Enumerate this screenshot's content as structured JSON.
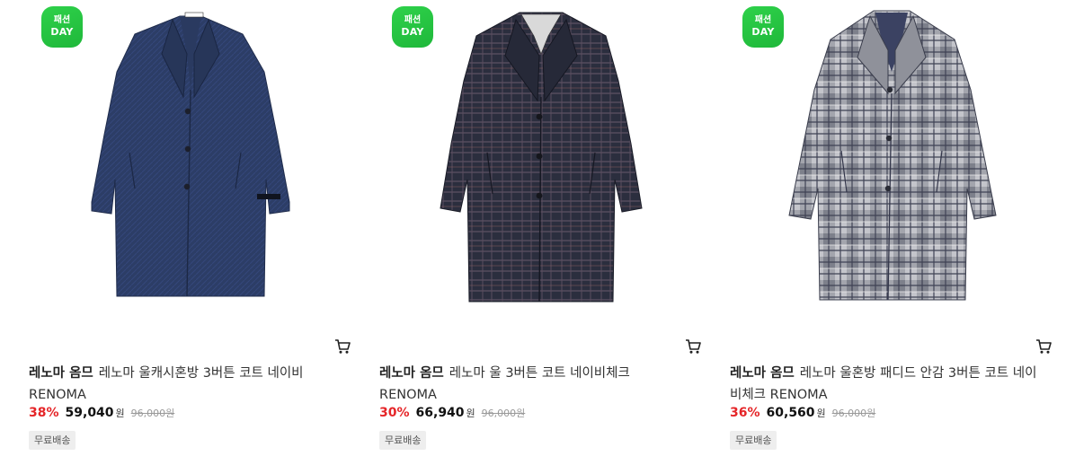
{
  "products": [
    {
      "badge": {
        "line1": "패션",
        "line2": "DAY"
      },
      "brand": "레노마 옴므",
      "name_line1": "레노마 울캐시혼방 3버튼 코트 네이비",
      "name_line2": "RENOMA",
      "discount": "38%",
      "price": "59,040",
      "unit": "원",
      "original_price": "96,000원",
      "shipping_tag": "무료배송",
      "image": {
        "alt_colors": {
          "main": "#2b3b63",
          "dark": "#1e2b4a",
          "light": "#3a4b78"
        }
      }
    },
    {
      "badge": {
        "line1": "패션",
        "line2": "DAY"
      },
      "brand": "레노마 옴므",
      "name_line1": "레노마 울 3버튼 코트 네이비체크",
      "name_line2": "RENOMA",
      "discount": "30%",
      "price": "66,940",
      "unit": "원",
      "original_price": "96,000원",
      "shipping_tag": "무료배송",
      "image": {
        "alt_colors": {
          "main": "#2a2d3c",
          "dark": "#1c1e29",
          "light": "#6b5a6a"
        }
      }
    },
    {
      "badge": {
        "line1": "패션",
        "line2": "DAY"
      },
      "brand": "레노마 옴므",
      "name_line1": "레노마 울혼방 패디드 안감 3버튼 코트 네이",
      "name_line2": "비체크 RENOMA",
      "discount": "36%",
      "price": "60,560",
      "unit": "원",
      "original_price": "96,000원",
      "shipping_tag": "무료배송",
      "image": {
        "alt_colors": {
          "main": "#8a8c96",
          "dark": "#4a4d5c",
          "light": "#c8c9cf"
        }
      }
    }
  ],
  "colors": {
    "discount": "#e52528",
    "badge": "#22c03d"
  }
}
